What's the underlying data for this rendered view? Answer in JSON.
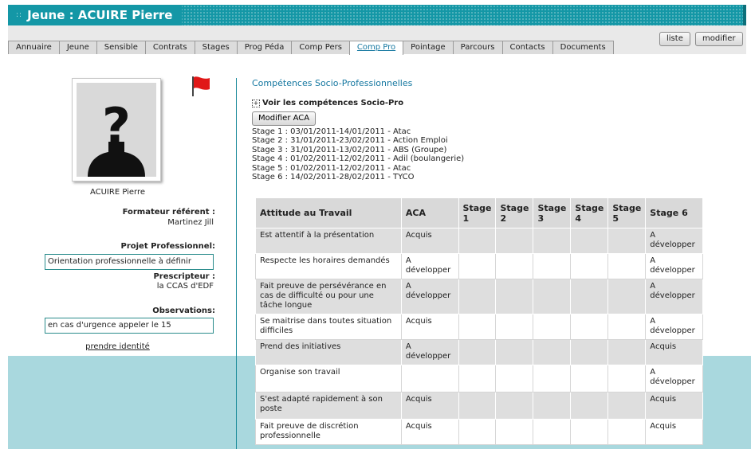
{
  "window": {
    "dots": "::",
    "title": "Jeune : ACUIRE Pierre"
  },
  "tabs": [
    {
      "label": "Annuaire",
      "active": false
    },
    {
      "label": "Jeune",
      "active": false
    },
    {
      "label": "Sensible",
      "active": false
    },
    {
      "label": "Contrats",
      "active": false
    },
    {
      "label": "Stages",
      "active": false
    },
    {
      "label": "Prog Péda",
      "active": false
    },
    {
      "label": "Comp Pers",
      "active": false
    },
    {
      "label": "Comp Pro",
      "active": true
    },
    {
      "label": "Pointage",
      "active": false
    },
    {
      "label": "Parcours",
      "active": false
    },
    {
      "label": "Contacts",
      "active": false
    },
    {
      "label": "Documents",
      "active": false
    }
  ],
  "toolbar": {
    "liste_label": "liste",
    "modifier_label": "modifier"
  },
  "profile": {
    "avatar_glyph": "?",
    "name": "ACUIRE Pierre",
    "formateur_label": "Formateur référent :",
    "formateur_value": "Martinez Jill",
    "projet_label": "Projet Professionnel:",
    "projet_value": "Orientation professionnelle à définir",
    "prescripteur_label": "Prescripteur :",
    "prescripteur_value": "la CCAS d'EDF",
    "observations_label": "Observations:",
    "observations_value": "en cas d'urgence appeler le 15",
    "identity_link": "prendre identité"
  },
  "main": {
    "section_title": "Compétences Socio-Professionnelles",
    "toggle_icon": "+",
    "toggle_label": "Voir les compétences Socio-Pro",
    "modify_button": "Modifier ACA",
    "stages": [
      "Stage 1 : 03/01/2011-14/01/2011 - Atac",
      "Stage 2 : 31/01/2011-23/02/2011 - Action Emploi",
      "Stage 3 : 31/01/2011-13/02/2011 - ABS (Groupe)",
      "Stage 4 : 01/02/2011-12/02/2011 - Adil (boulangerie)",
      "Stage 5 : 01/02/2011-12/02/2011 - Atac",
      "Stage 6 : 14/02/2011-28/02/2011 - TYCO"
    ]
  },
  "table": {
    "headers": [
      "Attitude au Travail",
      "ACA",
      "Stage 1",
      "Stage 2",
      "Stage 3",
      "Stage 4",
      "Stage 5",
      "Stage 6"
    ],
    "rows": [
      [
        "Est attentif à la présentation",
        "Acquis",
        "",
        "",
        "",
        "",
        "",
        "A développer"
      ],
      [
        "Respecte les horaires demandés",
        "A développer",
        "",
        "",
        "",
        "",
        "",
        "A développer"
      ],
      [
        "Fait preuve de persévérance en cas de difficulté ou pour une tâche longue",
        "A développer",
        "",
        "",
        "",
        "",
        "",
        "A développer"
      ],
      [
        "Se maitrise dans toutes situation difficiles",
        "Acquis",
        "",
        "",
        "",
        "",
        "",
        "A développer"
      ],
      [
        "Prend des initiatives",
        "A développer",
        "",
        "",
        "",
        "",
        "",
        "Acquis"
      ],
      [
        "Organise son travail",
        "",
        "",
        "",
        "",
        "",
        "",
        "A développer"
      ],
      [
        "S'est adapté rapidement à son poste",
        "Acquis",
        "",
        "",
        "",
        "",
        "",
        "Acquis"
      ],
      [
        "Fait preuve de discrétion professionnelle",
        "Acquis",
        "",
        "",
        "",
        "",
        "",
        "Acquis"
      ]
    ]
  },
  "colors": {
    "titlebar": "#1497a6",
    "accent": "#1477a0",
    "band": "#a9d8de",
    "flag": "#e01818"
  },
  "icons": {
    "flag": "flag-icon",
    "avatar": "unknown-person-icon",
    "expand": "expand-plus-icon"
  }
}
